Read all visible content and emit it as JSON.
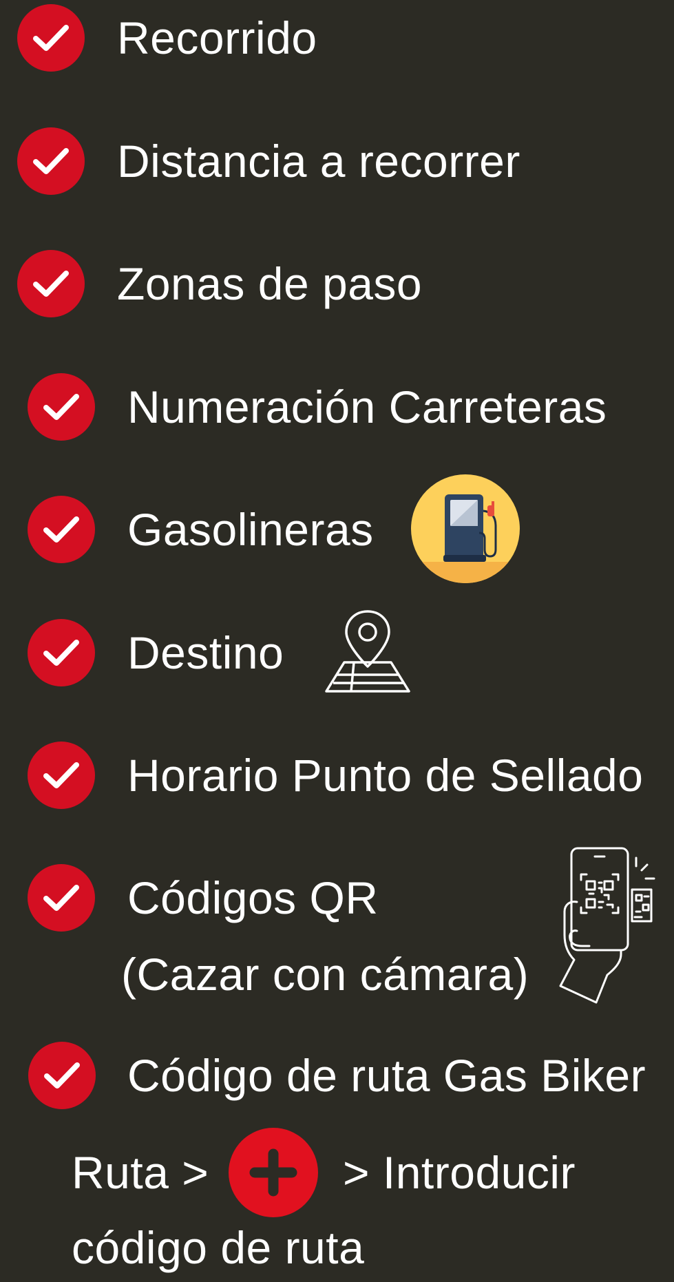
{
  "colors": {
    "background": "#2c2b24",
    "check_red": "#d40f22",
    "plus_red": "#e1111f",
    "text": "#ffffff",
    "fuel_circle": "#fdd05b"
  },
  "checklist": {
    "items": [
      {
        "label": "Recorrido",
        "icon": "check-icon"
      },
      {
        "label": "Distancia a recorrer",
        "icon": "check-icon"
      },
      {
        "label": "Zonas de paso",
        "icon": "check-icon"
      },
      {
        "label": "Numeración Carreteras",
        "icon": "check-icon"
      },
      {
        "label": "Gasolineras",
        "icon": "check-icon",
        "extra_icon": "fuel-pump-icon"
      },
      {
        "label": "Destino",
        "icon": "check-icon",
        "extra_icon": "map-pin-icon"
      },
      {
        "label": "Horario Punto de Sellado",
        "icon": "check-icon"
      },
      {
        "label": "Códigos QR",
        "label_line2": "(Cazar con cámara)",
        "icon": "check-icon",
        "extra_icon": "phone-qr-scan-icon"
      },
      {
        "label": "Código de ruta Gas Biker",
        "icon": "check-icon"
      }
    ]
  },
  "instructions": {
    "part1": "Ruta >",
    "button_icon": "plus-icon",
    "part2": "> Introducir",
    "line2": "código de ruta"
  }
}
